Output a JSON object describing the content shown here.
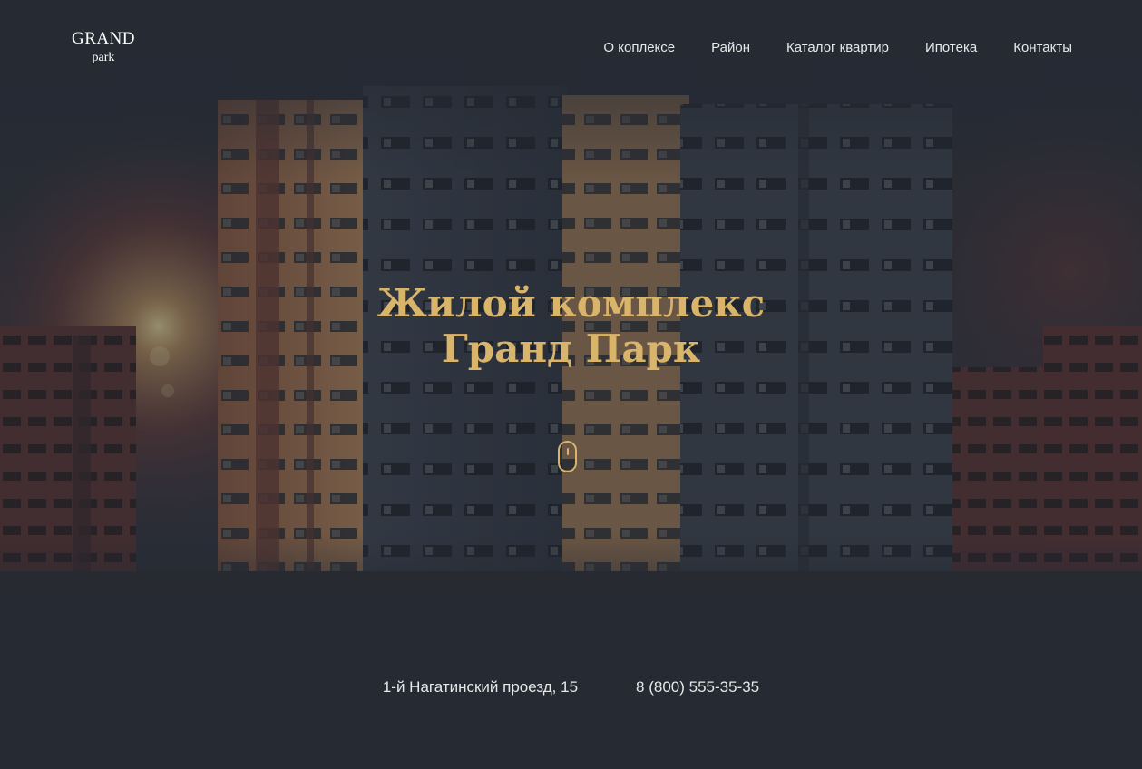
{
  "logo": {
    "main": "GRAND",
    "sub": "park"
  },
  "nav": {
    "items": [
      {
        "label": "О коплексе"
      },
      {
        "label": "Район"
      },
      {
        "label": "Каталог квартир"
      },
      {
        "label": "Ипотека"
      },
      {
        "label": "Контакты"
      }
    ]
  },
  "hero": {
    "title_line1": "Жилой комплекс",
    "title_line2": "Гранд Парк",
    "scroll_icon": "mouse-scroll-icon"
  },
  "info": {
    "address": "1-й Нагатинский проезд, 15",
    "phone": "8 (800) 555-35-35"
  },
  "colors": {
    "background": "#252a33",
    "accent": "#d9b56c",
    "text": "#e8e8e8"
  }
}
